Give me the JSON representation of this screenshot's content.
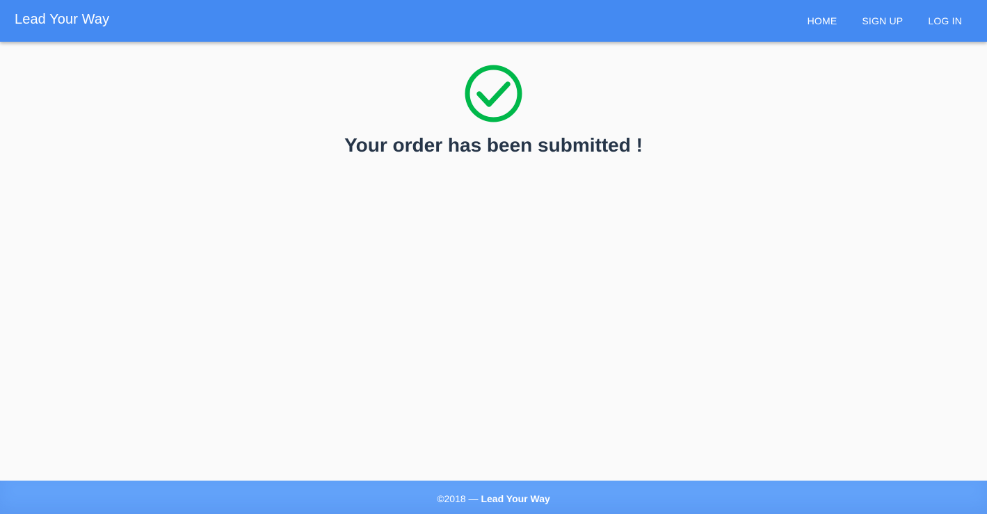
{
  "header": {
    "brand": "Lead Your Way",
    "nav": [
      {
        "label": "HOME"
      },
      {
        "label": "SIGN UP"
      },
      {
        "label": "LOG IN"
      }
    ]
  },
  "main": {
    "icon": "check-circle-icon",
    "message": "Your order has been submitted !"
  },
  "footer": {
    "copyright": "©2018 —",
    "brand": "Lead Your Way"
  },
  "colors": {
    "header_bg": "#448af2",
    "footer_bg": "#62a2f9",
    "success_green": "#00b84a",
    "message_text": "#263548",
    "page_bg": "#fafafa"
  }
}
